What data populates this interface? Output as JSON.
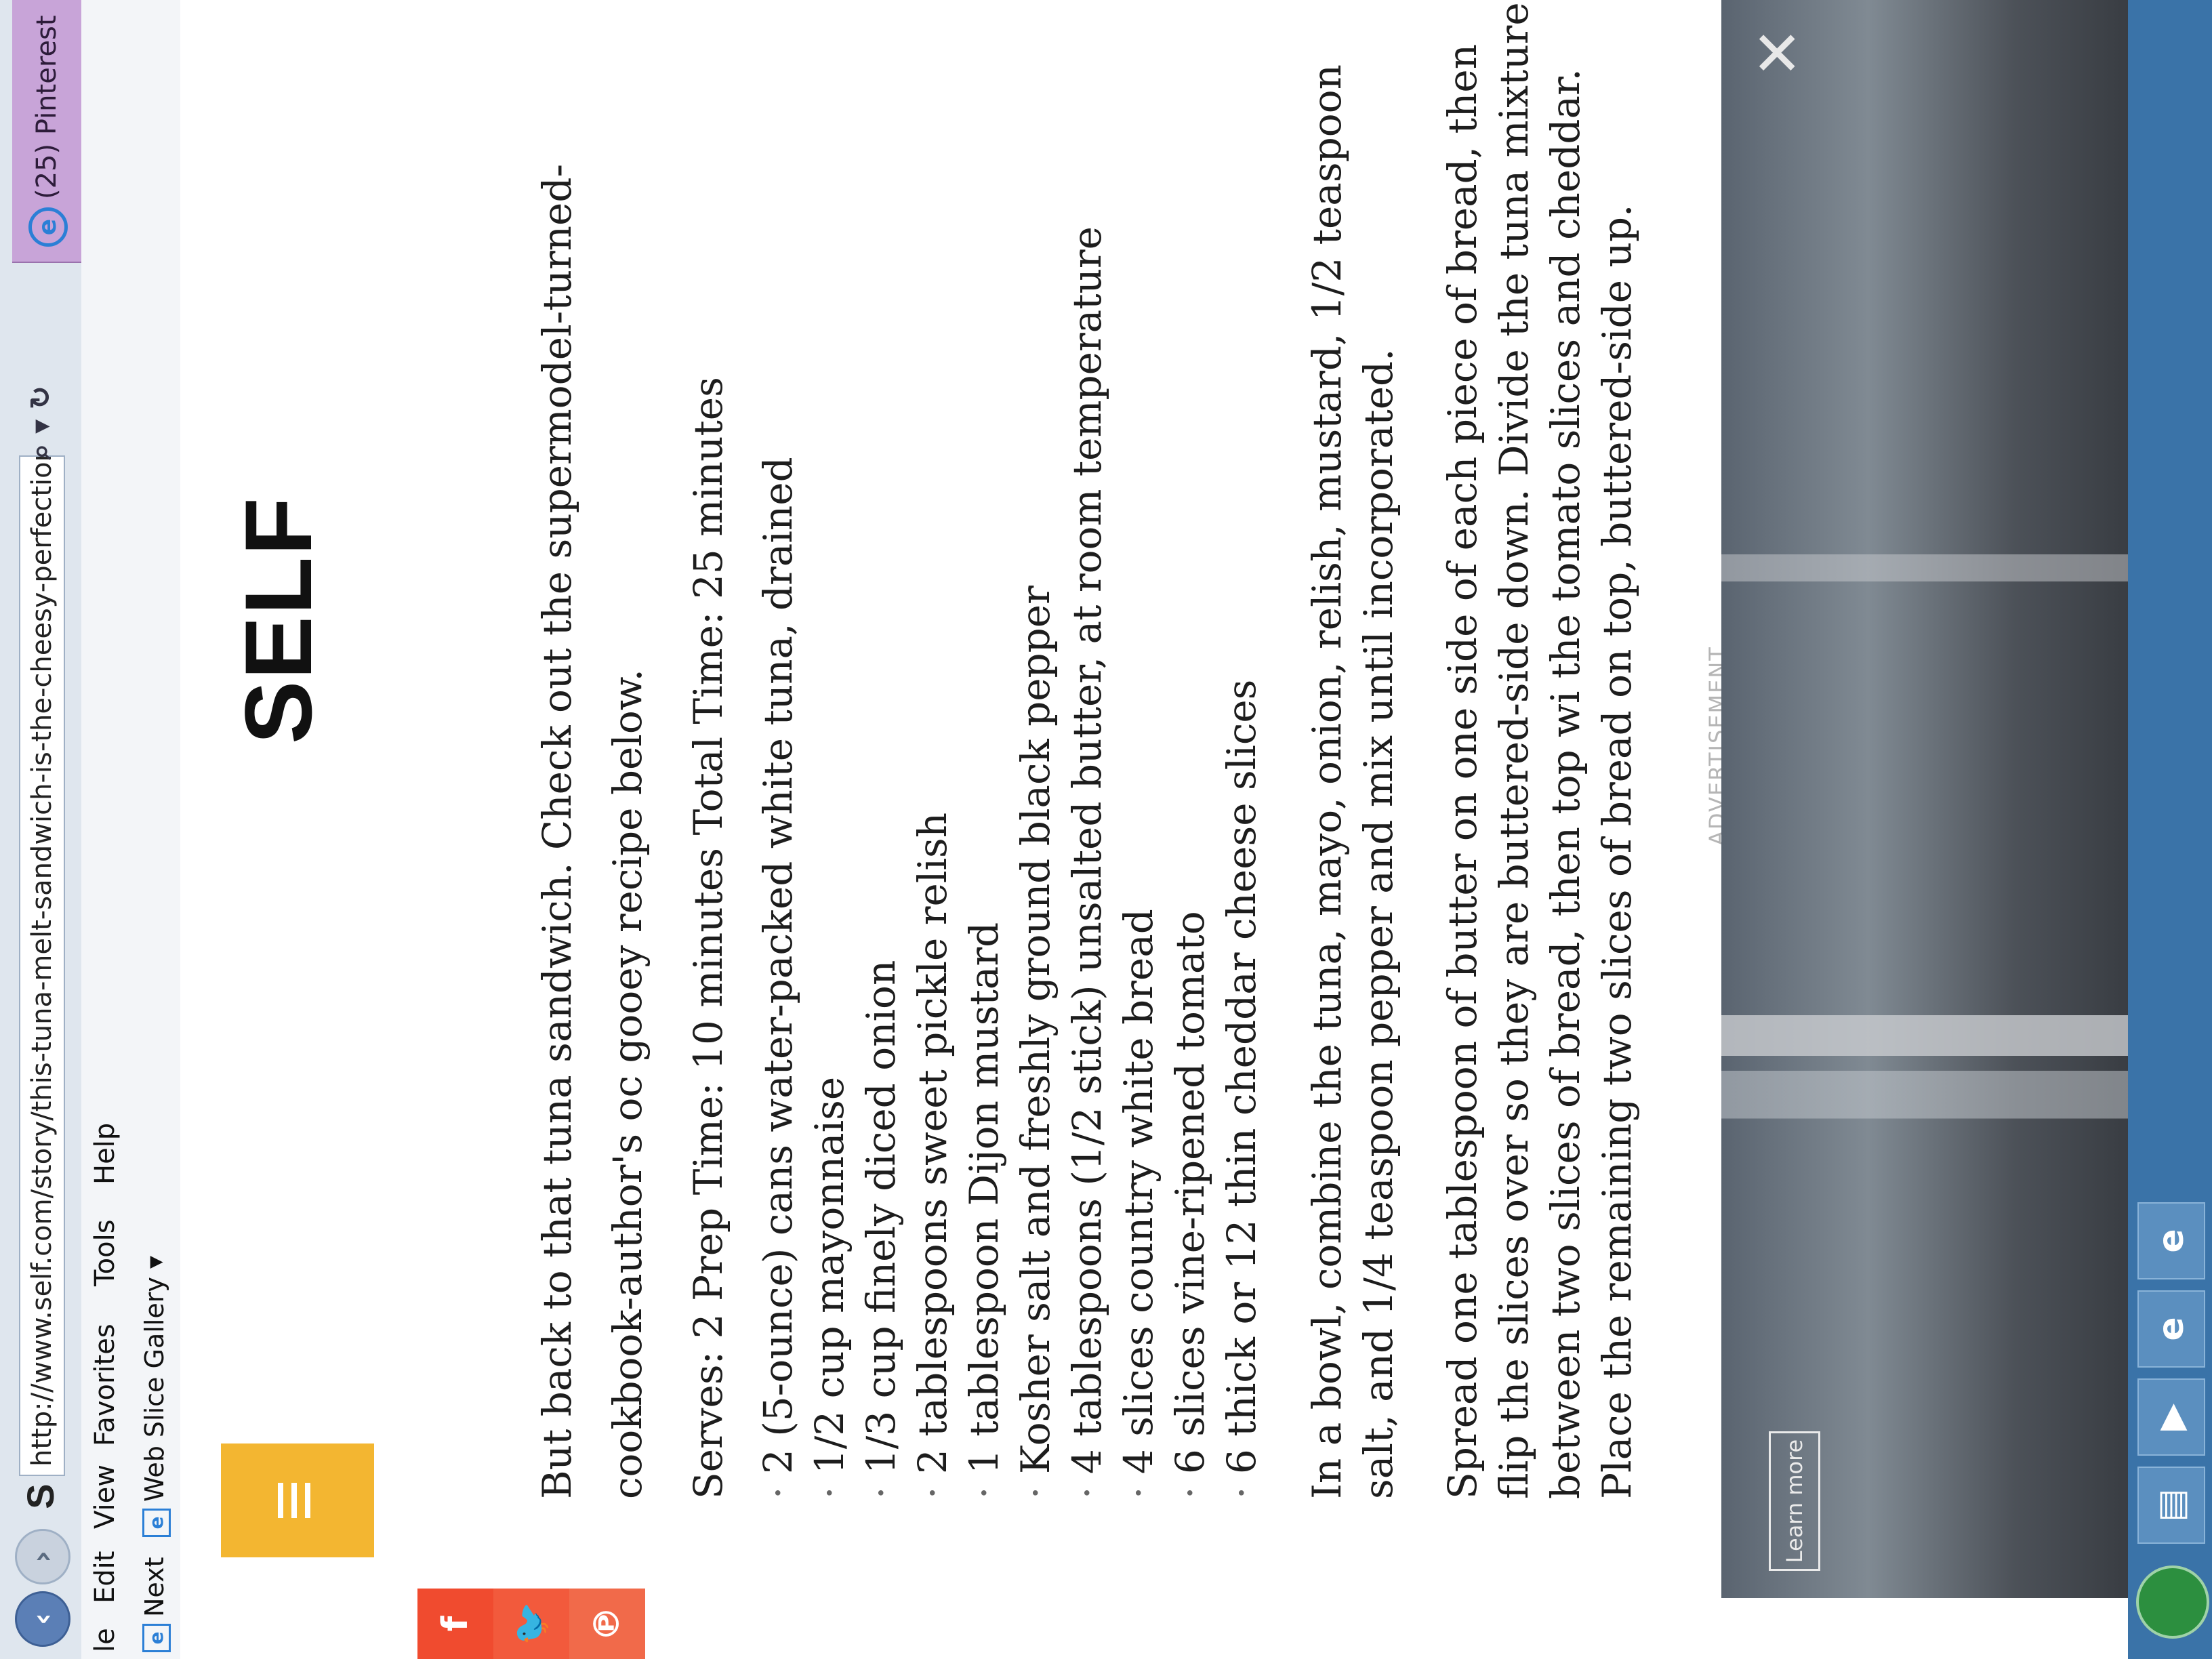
{
  "browser": {
    "url": "http://www.self.com/story/this-tuna-melt-sandwich-is-the-cheesy-perfection-you-need?c",
    "tab_title": "(25) Pinterest",
    "menu": [
      "le",
      "Edit",
      "View",
      "Favorites",
      "Tools",
      "Help"
    ],
    "favorites": {
      "next_label": "Next",
      "web_slice_label": "Web Slice Gallery ▾"
    },
    "site_icon": "S"
  },
  "site": {
    "logo": "SELF"
  },
  "share": {
    "facebook": "f",
    "twitter": "🐦",
    "pinterest": "℗"
  },
  "article": {
    "lead": "But back to that tuna sandwich. Check out the supermodel-turned-cookbook-author's oc gooey recipe below.",
    "serves": "Serves: 2 Prep Time: 10 minutes Total Time: 25 minutes",
    "ingredients": [
      "2 (5-ounce) cans water-packed white tuna, drained",
      "1/2 cup mayonnaise",
      "1/3 cup finely diced onion",
      "2 tablespoons sweet pickle relish",
      "1 tablespoon Dijon mustard",
      "Kosher salt and freshly ground black pepper",
      "4 tablespoons (1/2 stick) unsalted butter, at room temperature",
      "4 slices country white bread",
      "6 slices vine-ripened tomato",
      "6 thick or 12 thin cheddar cheese slices"
    ],
    "step1": "In a bowl, combine the tuna, mayo, onion, relish, mustard, 1/2 teaspoon salt, and 1/4 teaspoon pepper and mix until incorporated.",
    "step2": "Spread one tablespoon of butter on one side of each piece of bread, then flip the slices over so they are buttered-side down. Divide the tuna mixture between two slices of bread, then top wi the tomato slices and cheddar. Place the remaining two slices of bread on top, buttered-side up."
  },
  "ad": {
    "label": "ADVERTISEMENT",
    "learn_more": "Learn more",
    "close": "✕"
  },
  "taskbar": {
    "icons": [
      "folder-icon",
      "media-player-icon",
      "ie-icon",
      "ie-icon"
    ]
  }
}
